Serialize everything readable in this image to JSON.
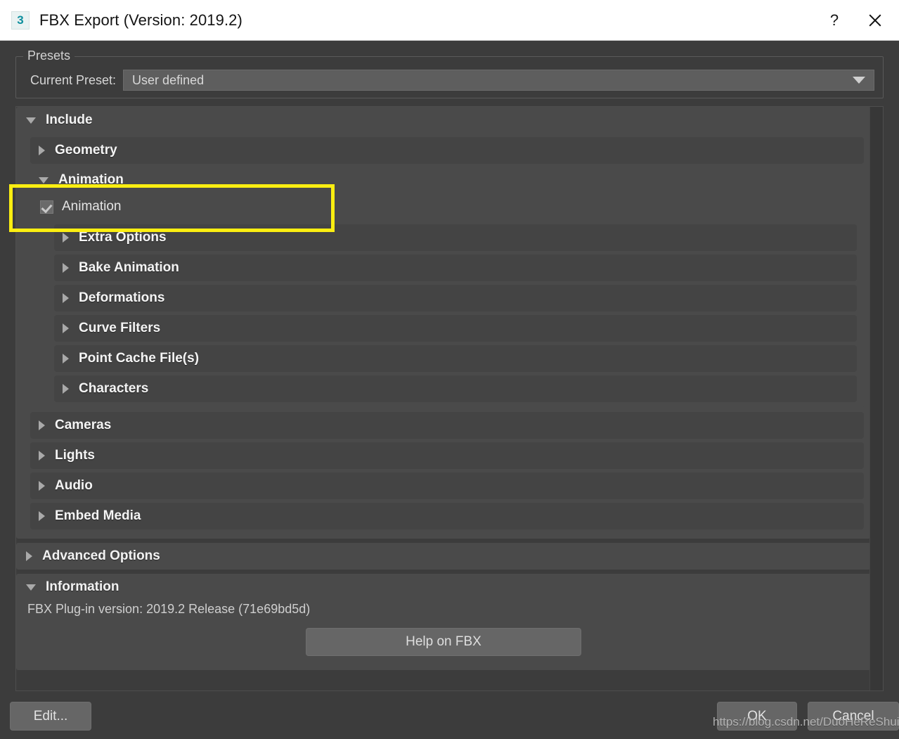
{
  "window": {
    "title": "FBX Export (Version: 2019.2)",
    "app_icon_glyph": "3",
    "help_button": "?",
    "close_button": "✕"
  },
  "presets": {
    "legend": "Presets",
    "current_preset_label": "Current Preset:",
    "current_preset_value": "User defined"
  },
  "include": {
    "title": "Include",
    "expanded": true,
    "items": [
      {
        "label": "Geometry",
        "expanded": false
      },
      {
        "label": "Animation",
        "expanded": true
      },
      {
        "label": "Cameras",
        "expanded": false
      },
      {
        "label": "Lights",
        "expanded": false
      },
      {
        "label": "Audio",
        "expanded": false
      },
      {
        "label": "Embed Media",
        "expanded": false
      }
    ]
  },
  "animation": {
    "title": "Animation",
    "checkbox_label": "Animation",
    "checkbox_checked": true,
    "sub_items": [
      {
        "label": "Extra Options",
        "expanded": false
      },
      {
        "label": "Bake Animation",
        "expanded": false
      },
      {
        "label": "Deformations",
        "expanded": false
      },
      {
        "label": "Curve Filters",
        "expanded": false
      },
      {
        "label": "Point Cache File(s)",
        "expanded": false
      },
      {
        "label": "Characters",
        "expanded": false
      }
    ]
  },
  "advanced_options": {
    "title": "Advanced Options",
    "expanded": false
  },
  "information": {
    "title": "Information",
    "expanded": true,
    "version_text": "FBX Plug-in version: 2019.2 Release (71e69bd5d)",
    "help_button_label": "Help on FBX"
  },
  "footer": {
    "edit_label": "Edit...",
    "ok_label": "OK",
    "cancel_label": "Cancel"
  },
  "annotation": {
    "highlight_color": "#fbee11",
    "watermark": "https://blog.csdn.net/DuoHeReShui"
  },
  "colors": {
    "dialog_background": "#3c3c3c",
    "panel_background": "#4a4a4a",
    "row_background": "#444444",
    "button_background": "#666666",
    "text_primary": "#f2f2f2",
    "text_secondary": "#cfcfcf",
    "titlebar_background": "#ffffff",
    "icon_accent": "#0e8f9e"
  }
}
